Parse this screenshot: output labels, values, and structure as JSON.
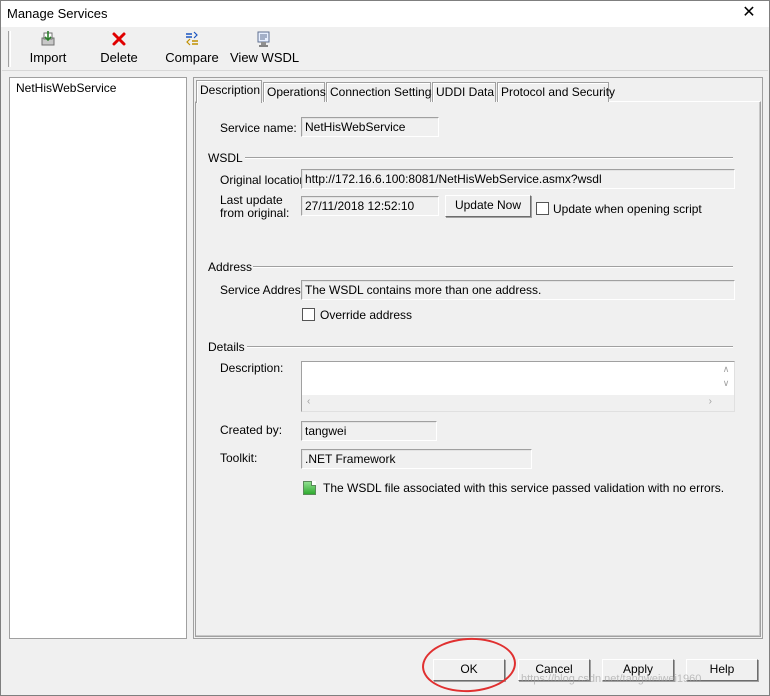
{
  "window": {
    "title": "Manage Services",
    "close_glyph": "✕"
  },
  "toolbar": {
    "import_label": "Import",
    "delete_label": "Delete",
    "compare_label": "Compare",
    "view_wsdl_label": "View WSDL",
    "icons": {
      "import": "import-icon",
      "delete": "delete-x-icon",
      "compare": "compare-icon",
      "view_wsdl": "view-wsdl-icon"
    },
    "delete_color": "#e00000"
  },
  "tree": {
    "items": [
      {
        "label": "NetHisWebService"
      }
    ]
  },
  "tabs": [
    {
      "label": "Description",
      "active": true
    },
    {
      "label": "Operations"
    },
    {
      "label": "Connection Settings"
    },
    {
      "label": "UDDI Data"
    },
    {
      "label": "Protocol and Security"
    }
  ],
  "description": {
    "service_name_label": "Service name:",
    "service_name_value": "NetHisWebService",
    "wsdl_group": "WSDL",
    "original_location_label": "Original location:",
    "original_location_value": "http://172.16.6.100:8081/NetHisWebService.asmx?wsdl",
    "last_update_label_1": "Last update",
    "last_update_label_2": "from original:",
    "last_update_value": "27/11/2018 12:52:10",
    "update_now_label": "Update Now",
    "update_on_open_label": "Update when opening script",
    "address_group": "Address",
    "service_address_label": "Service Address:",
    "service_address_value": "The WSDL contains more than one address.",
    "override_address_label": "Override address",
    "details_group": "Details",
    "description_label": "Description:",
    "created_by_label": "Created by:",
    "created_by_value": "tangwei",
    "toolkit_label": "Toolkit:",
    "toolkit_value": ".NET Framework",
    "validation_message": "The WSDL file associated with this service passed validation with no errors.",
    "validation_icon": "validation-ok-icon",
    "validation_color": "#3cb43c"
  },
  "footer": {
    "ok_label": "OK",
    "cancel_label": "Cancel",
    "apply_label": "Apply",
    "help_label": "Help",
    "highlight_color": "#e03030"
  },
  "watermark": "https://blog.csdn.net/tangweiwei1960"
}
